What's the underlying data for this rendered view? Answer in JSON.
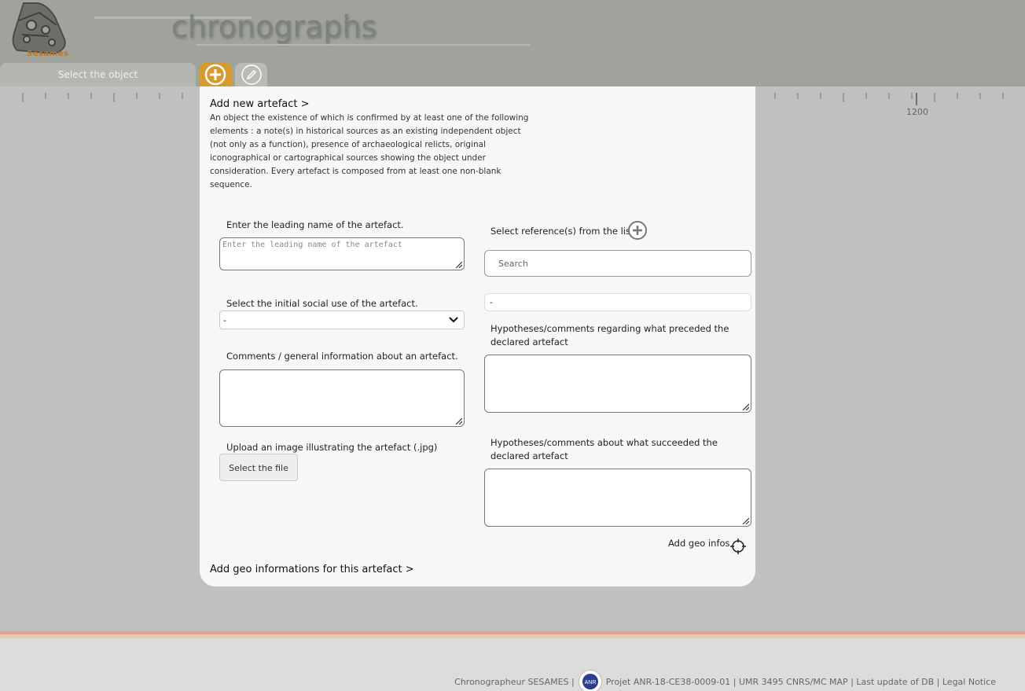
{
  "header": {
    "logo_text": "Sesames",
    "app_title": "chronographs",
    "tabs": {
      "select_object": "Select the object",
      "add": "add-icon",
      "edit": "pencil-icon"
    }
  },
  "ruler": {
    "label": "1200"
  },
  "modal": {
    "title": "Add new artefact >",
    "description": "An object the existence of which is confirmed by at least one of the following elements : a note(s) in historical sources as an existing independent object (not only as a function), presence of archaeological relicts, original iconographical or cartographical sources showing the object under consideration. Every artefact is composed from at least one non-blank sequence.",
    "leading_name": {
      "label": "Enter the leading name of the artefact.",
      "placeholder": "Enter the leading name of the artefact"
    },
    "social_use": {
      "label": "Select the initial social use of the artefact.",
      "selected": "-"
    },
    "comments": {
      "label": "Comments / general information about an artefact."
    },
    "upload": {
      "label": "Upload an image illustrating the artefact (.jpg)",
      "button": "Select the file"
    },
    "references": {
      "label": "Select reference(s) from the list.",
      "search_placeholder": "Search",
      "list_value": "-"
    },
    "preceded": {
      "label": "Hypotheses/comments regarding what preceded the declared artefact"
    },
    "succeeded": {
      "label": "Hypotheses/comments about what succeeded the declared artefact"
    },
    "geo_link": "Add geo infos",
    "geo_section": "Add geo informations for this artefact >"
  },
  "footer": {
    "chronographer": "Chronographeur SESAMES |",
    "logo_text": "ANR",
    "project": "Projet ANR-18-CE38-0009-01 | UMR 3495 CNRS/MC MAP | Last update of DB | Legal Notice"
  },
  "colors": {
    "header_bg": "#9fa39b",
    "add_tab": "#d79a2f",
    "body_bg": "#c0c0c0",
    "footer_accent": "#e0a58c"
  }
}
